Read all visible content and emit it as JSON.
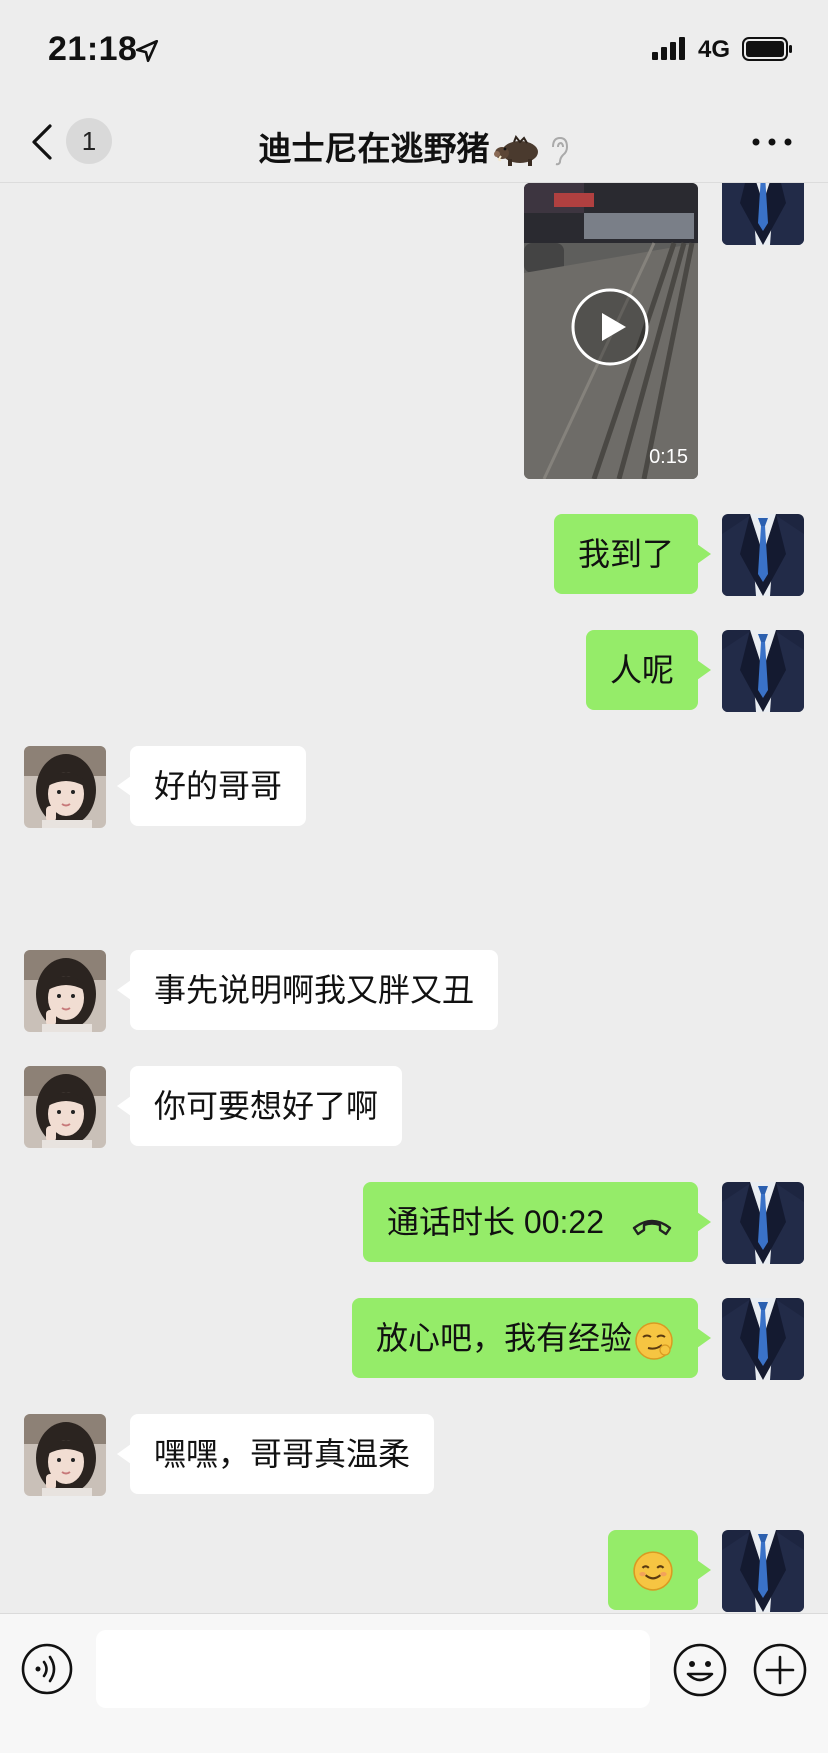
{
  "status_bar": {
    "time": "21:18",
    "network": "4G",
    "icons": [
      "location-arrow-icon",
      "signal-icon",
      "battery-icon"
    ]
  },
  "nav": {
    "unread_count": "1",
    "title": "迪士尼在逃野猪",
    "icons": [
      "back-chevron-icon",
      "boar-emoji-icon",
      "earpiece-mode-icon",
      "more-icon"
    ]
  },
  "messages": [
    {
      "side": "me",
      "type": "video",
      "duration": "0:15"
    },
    {
      "side": "me",
      "type": "text",
      "text": "我到了"
    },
    {
      "side": "me",
      "type": "text",
      "text": "人呢"
    },
    {
      "side": "her",
      "type": "text",
      "text": "好的哥哥"
    },
    {
      "side": "her",
      "type": "text",
      "text": "事先说明啊我又胖又丑"
    },
    {
      "side": "her",
      "type": "text",
      "text": "你可要想好了啊"
    },
    {
      "side": "me",
      "type": "call",
      "text": "通话时长 00:22"
    },
    {
      "side": "me",
      "type": "text",
      "text": "放心吧，我有经验"
    },
    {
      "side": "her",
      "type": "text",
      "text": "嘿嘿，哥哥真温柔"
    },
    {
      "side": "me",
      "type": "emoji",
      "emoji": "smile-emoji-icon"
    }
  ],
  "input_bar": {
    "icons": [
      "voice-icon",
      "emoji-icon",
      "plus-icon"
    ]
  },
  "colors": {
    "background": "#ededed",
    "my_bubble": "#95ec69",
    "her_bubble": "#ffffff"
  }
}
